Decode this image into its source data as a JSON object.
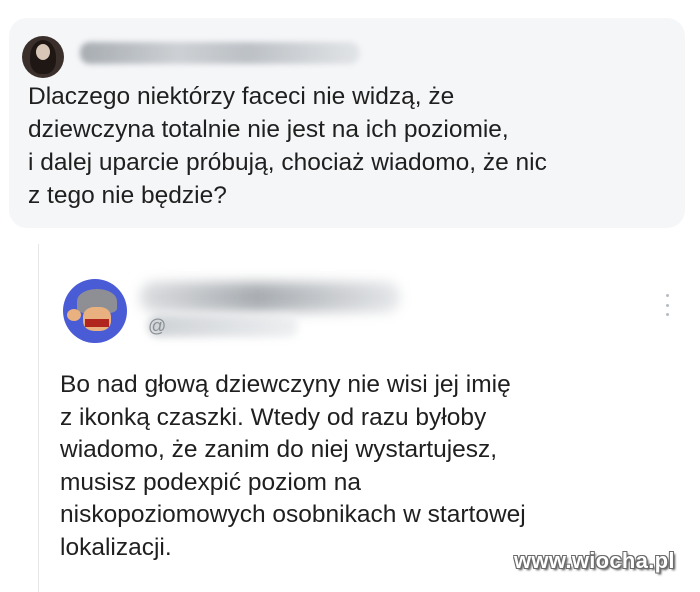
{
  "original_post": {
    "text": "Dlaczego niektórzy faceci nie widzą, że\ndziewczyna totalnie nie jest na ich poziomie,\ni dalej uparcie próbują, chociaż wiadomo, że nic\nz tego nie będzie?"
  },
  "reply": {
    "handle_prefix": "@",
    "text": "Bo nad głową dziewczyny nie wisi jej imię\nz ikonką czaszki. Wtedy od razu byłoby\nwiadomo, że zanim do niej wystartujesz,\nmusisz podexpić poziom na\nniskopoziomowych osobnikach w startowej\nlokalizacji."
  },
  "icons": {
    "more": "vertical-ellipsis-icon"
  },
  "watermark": {
    "text": "www.wiocha.pl"
  },
  "colors": {
    "card_background": "#f5f6f8",
    "reply_avatar": "#4a5bd6",
    "text": "#1f1f1f"
  }
}
